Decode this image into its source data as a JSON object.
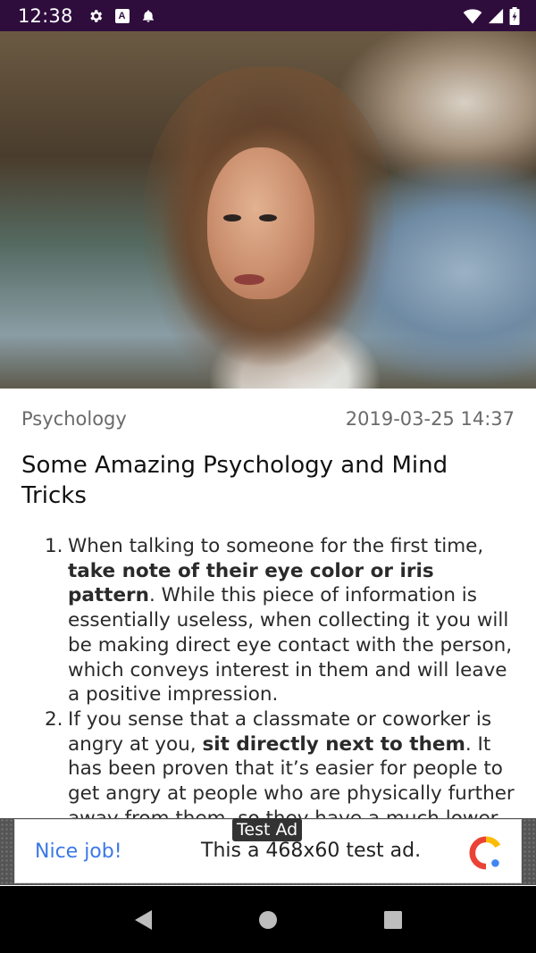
{
  "status_bar": {
    "time": "12:38",
    "left_icons": [
      "gear-icon",
      "a-badge-icon",
      "notification-bell-icon"
    ],
    "a_badge_text": "A",
    "right_icons": [
      "wifi-icon",
      "cellular-signal-icon",
      "battery-icon"
    ]
  },
  "hero": {
    "description_icon": "hero-photo"
  },
  "post": {
    "category": "Psychology",
    "datetime": "2019-03-25 14:37",
    "title": "Some Amazing Psychology and Mind Tricks",
    "items": [
      {
        "number": "1.",
        "pre": "When talking to someone for the first time, ",
        "bold": "take note of their eye color or iris pattern",
        "post": ". While this piece of information is essentially useless, when collecting it you will be making direct eye contact with the person, which conveys interest in them and will leave a positive impression."
      },
      {
        "number": "2.",
        "pre": "If you sense that a classmate or coworker is angry at you, ",
        "bold": "sit directly next to them",
        "post": ". It has been proven that it’s easier for people to get angry at people who are physically further away from them, so they have a much lower chance of"
      }
    ]
  },
  "ad": {
    "tag": "Test Ad",
    "headline": "Nice job!",
    "body": "This a 468x60 test ad.",
    "logo_colors": [
      "#ea4335",
      "#fbbc05",
      "#4285f4"
    ]
  },
  "nav_bar": {
    "buttons": [
      "back-icon",
      "home-icon",
      "recents-icon"
    ]
  },
  "colors": {
    "status_bar_bg": "#2e0d3d",
    "ad_headline": "#3b78e7",
    "meta_text": "#6a6a6a"
  }
}
